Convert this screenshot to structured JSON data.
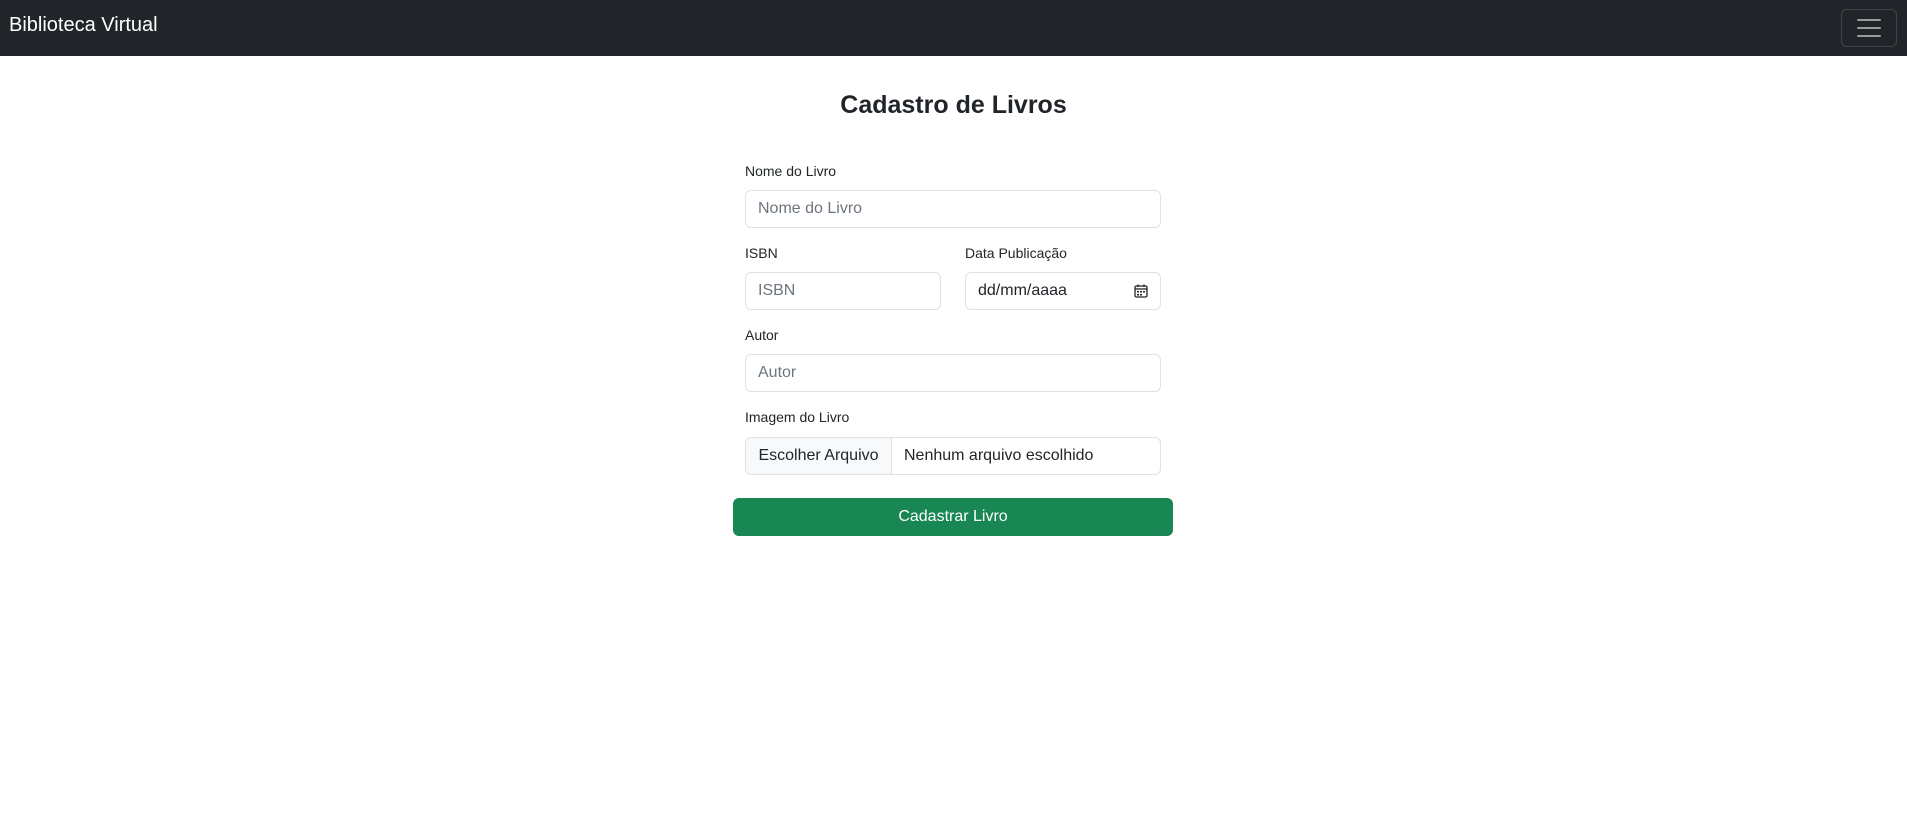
{
  "navbar": {
    "brand": "Biblioteca Virtual",
    "toggler_icon": "hamburger-menu-icon"
  },
  "page": {
    "title": "Cadastro de Livros"
  },
  "form": {
    "nome": {
      "label": "Nome do Livro",
      "placeholder": "Nome do Livro"
    },
    "isbn": {
      "label": "ISBN",
      "placeholder": "ISBN"
    },
    "data": {
      "label": "Data Publicação",
      "value": "dd/mm/aaaa",
      "icon": "calendar-icon"
    },
    "autor": {
      "label": "Autor",
      "placeholder": "Autor"
    },
    "imagem": {
      "label": "Imagem do Livro",
      "button": "Escolher Arquivo",
      "status": "Nenhum arquivo escolhido"
    },
    "submit_label": "Cadastrar Livro"
  },
  "colors": {
    "navbar_bg": "#212529",
    "submit_bg": "#198754",
    "border": "#dee2e6"
  }
}
